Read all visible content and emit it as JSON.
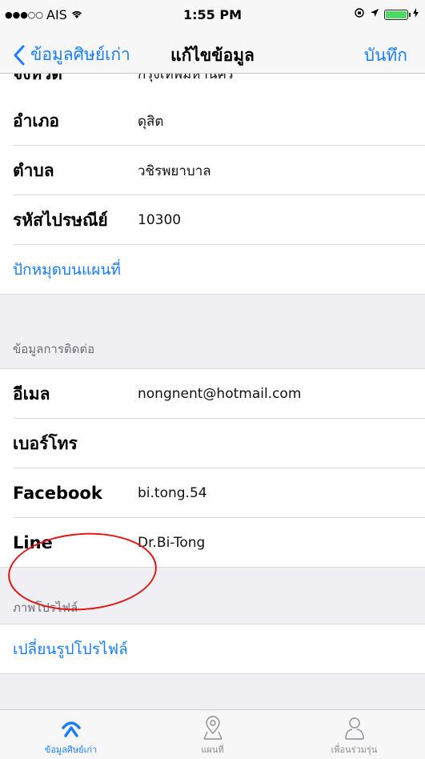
{
  "status_bar": {
    "carrier": "AIS",
    "signal": "●●●○○",
    "time": "1:55 PM",
    "battery_color": "#4cd964"
  },
  "nav": {
    "back_label": "ข้อมูลศิษย์เก่า",
    "title": "แก้ไขข้อมูล",
    "save_label": "บันทึก"
  },
  "address": {
    "partial_label": "จังหวัด",
    "partial_value": "กรุงเทพมหานคร",
    "rows": [
      {
        "label": "อำเภอ",
        "value": "ดุสิต"
      },
      {
        "label": "ตำบล",
        "value": "วชิรพยาบาล"
      },
      {
        "label": "รหัสไปรษณีย์",
        "value": "10300"
      }
    ],
    "map_link": "ปักหมุดบนแผนที่"
  },
  "contact": {
    "header": "ข้อมูลการติดต่อ",
    "rows": [
      {
        "label": "อีเมล",
        "value": "nongnent@hotmail.com"
      },
      {
        "label": "เบอร์โทร",
        "value": ""
      },
      {
        "label": "Facebook",
        "value": "bi.tong.54"
      },
      {
        "label": "Line",
        "value": "Dr.Bi-Tong"
      }
    ]
  },
  "profile": {
    "header": "ภาพโปรไฟล์",
    "change_link": "เปลี่ยนรูปโปรไฟล์"
  },
  "tabs": [
    {
      "label": "ข้อมูลศิษย์เก่า",
      "icon": "alumni-icon",
      "active": true
    },
    {
      "label": "แผนที่",
      "icon": "map-pin-icon",
      "active": false
    },
    {
      "label": "เพื่อนร่วมรุ่น",
      "icon": "person-icon",
      "active": false
    }
  ],
  "colors": {
    "accent": "#1a7cff",
    "annotation": "#e01818"
  }
}
